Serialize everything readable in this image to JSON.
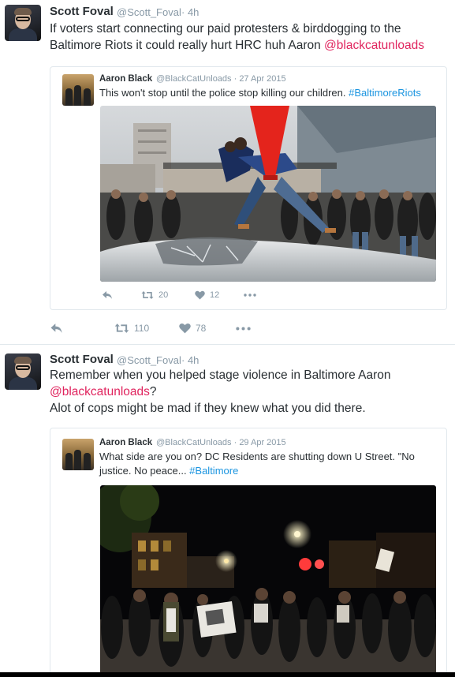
{
  "tweets": [
    {
      "author_name": "Scott Foval",
      "author_handle": "@Scott_Foval",
      "time": "· 4h",
      "text_parts": {
        "line1": "If voters start connecting our paid protesters & birddogging to the",
        "line2_pre": "Baltimore Riots it could really hurt HRC huh Aaron ",
        "line2_mention": "@blackcatunloads"
      },
      "quote": {
        "author_name": "Aaron Black",
        "author_handle": "@BlackCatUnloads · 27 Apr 2015",
        "text_pre": "This won't stop until the police stop killing our children. ",
        "hashtag": "#BaltimoreRiots",
        "retweets": "20",
        "likes": "12"
      },
      "retweets": "110",
      "likes": "78"
    },
    {
      "author_name": "Scott Foval",
      "author_handle": "@Scott_Foval",
      "time": "· 4h",
      "text_parts": {
        "line1": "Remember when you helped stage violence in Baltimore Aaron",
        "line2_mention": "@blackcatunloads",
        "line2_post": "?",
        "line3": "Alot of cops might be mad if they knew what you did there."
      },
      "quote": {
        "author_name": "Aaron Black",
        "author_handle": "@BlackCatUnloads · 29 Apr 2015",
        "line1": "What side are you on? DC Residents are shutting down U Street. \"No",
        "line2_pre": "justice. No peace... ",
        "hashtag": "#Baltimore"
      }
    }
  ],
  "icons": {
    "reply": "reply-icon",
    "retweet": "retweet-icon",
    "like": "heart-icon",
    "more": "more-icon"
  },
  "colors": {
    "mention": "#e0245e",
    "hashtag": "#1b95e0",
    "secondary": "#8899a6",
    "border": "#e1e8ed"
  }
}
